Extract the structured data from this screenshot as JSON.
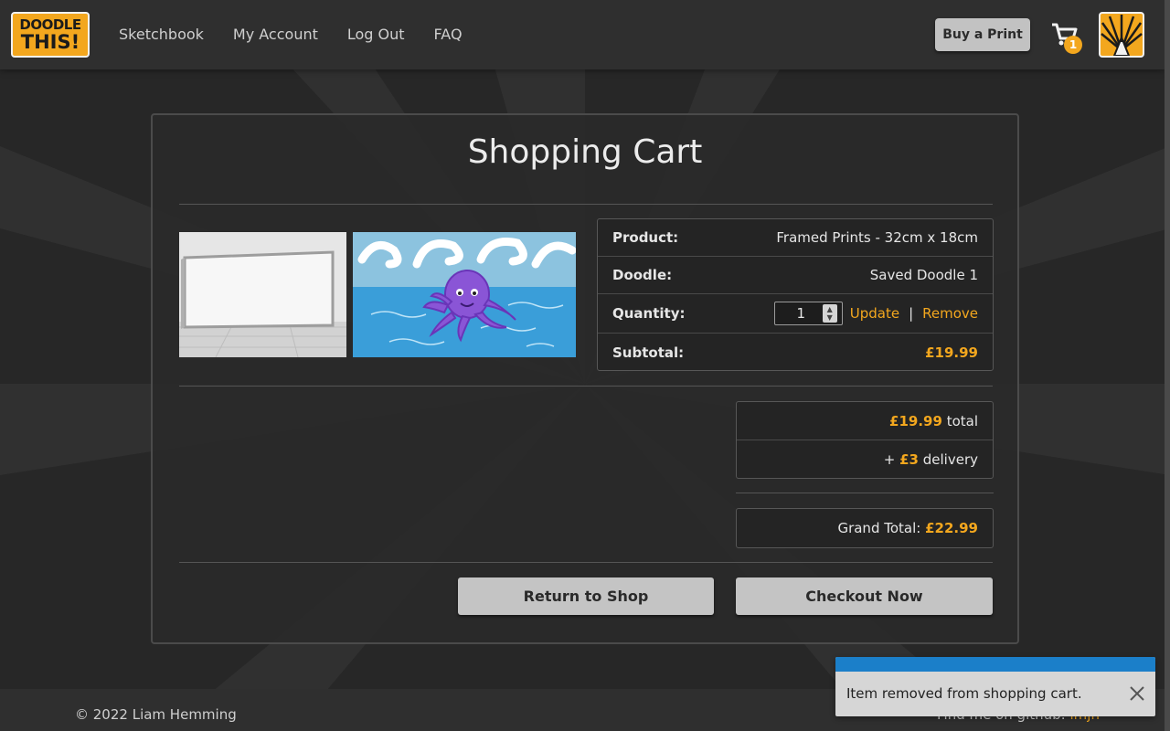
{
  "brand": {
    "line1": "DOODLE",
    "line2": "THIS!"
  },
  "nav": {
    "links": [
      "Sketchbook",
      "My Account",
      "Log Out",
      "FAQ"
    ]
  },
  "header": {
    "buy_label": "Buy a Print",
    "cart_count": "1"
  },
  "cart": {
    "title": "Shopping Cart",
    "product_label": "Product:",
    "product_value": "Framed Prints - 32cm x 18cm",
    "doodle_label": "Doodle:",
    "doodle_value": "Saved Doodle 1",
    "quantity_label": "Quantity:",
    "quantity_value": "1",
    "update_label": "Update",
    "separator": "|",
    "remove_label": "Remove",
    "subtotal_label": "Subtotal:",
    "subtotal_value": "£19.99",
    "total_amount": "£19.99",
    "total_word": "total",
    "delivery_prefix": "+",
    "delivery_amount": "£3",
    "delivery_word": "delivery",
    "grand_label": "Grand Total:",
    "grand_value": "£22.99",
    "return_label": "Return to Shop",
    "checkout_label": "Checkout Now"
  },
  "footer": {
    "copyright": "© 2022 Liam Hemming",
    "github_text": "Find me on github:",
    "github_link": "lmjh"
  },
  "toast": {
    "message": "Item removed from shopping cart."
  },
  "colors": {
    "accent": "#f3a71e",
    "toast_bar": "#1b7fc9",
    "background": "#272727"
  },
  "icons": [
    "cart-icon",
    "close-icon",
    "sunburst-pencil-icon",
    "spinner-icon"
  ]
}
